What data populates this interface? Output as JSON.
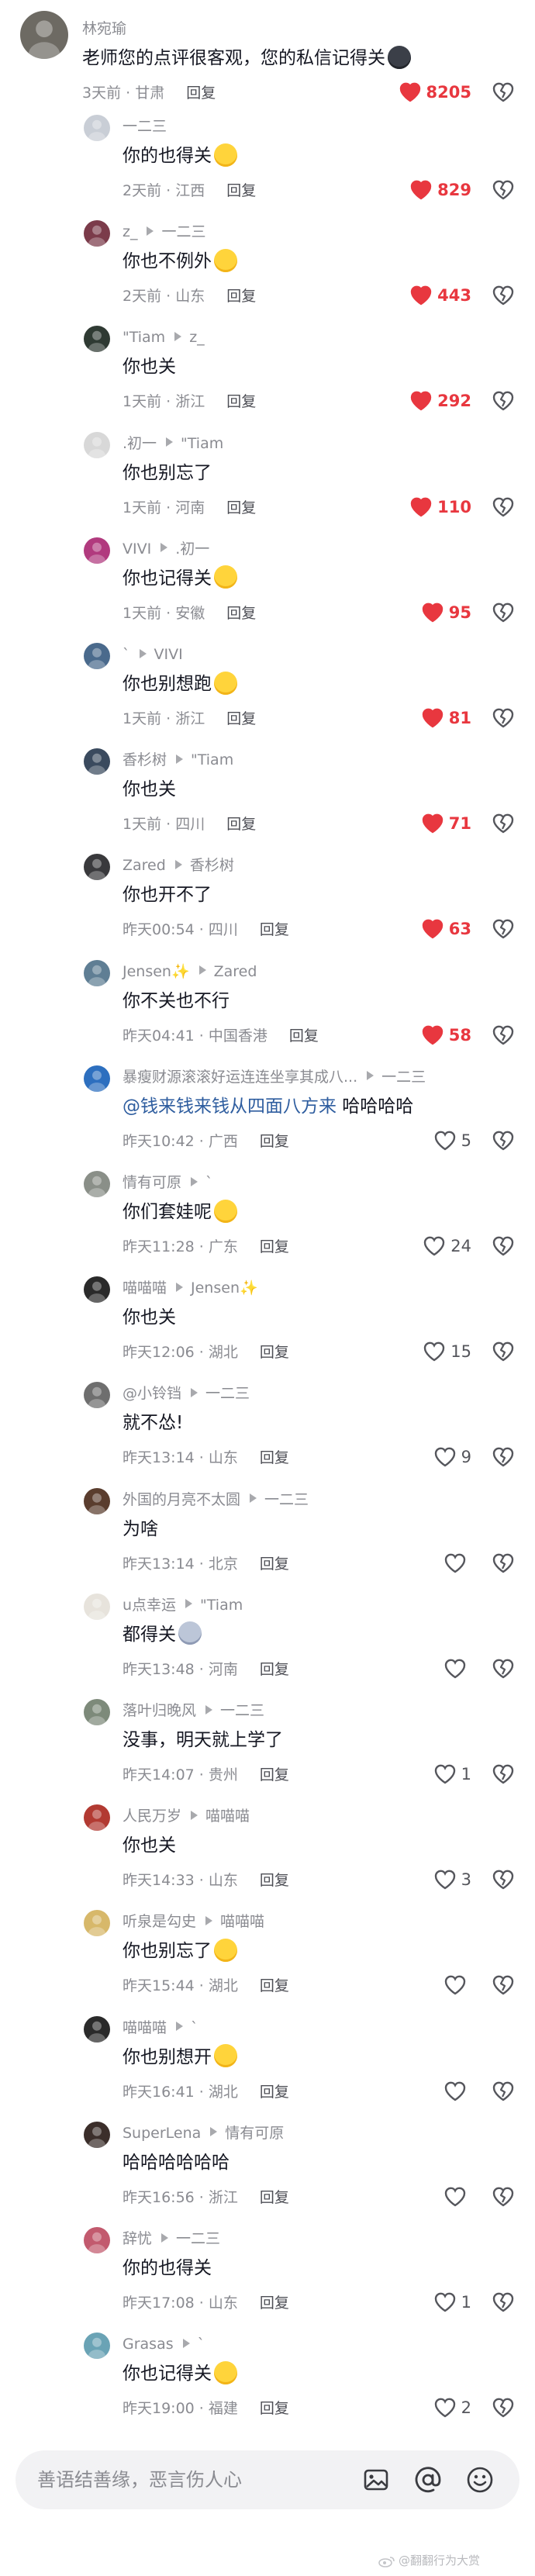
{
  "comments": [
    {
      "indent": false,
      "user": "林宛瑜",
      "reply_to": "",
      "text": "老师您的点评很客观，您的私信记得关",
      "emoji": "dark-face",
      "time": "3天前",
      "region": "甘肃",
      "reply_label": "回复",
      "likes": "8205",
      "liked": true,
      "avatar_color": "#6d6a63"
    },
    {
      "indent": true,
      "user": "一二三",
      "reply_to": "",
      "text": "你的也得关",
      "emoji": "smirk-face",
      "time": "2天前",
      "region": "江西",
      "reply_label": "回复",
      "likes": "829",
      "liked": true,
      "avatar_color": "#c9ced6"
    },
    {
      "indent": true,
      "user": "z_",
      "reply_to": "一二三",
      "text": "你也不例外",
      "emoji": "laugh-cry-face",
      "time": "2天前",
      "region": "山东",
      "reply_label": "回复",
      "likes": "443",
      "liked": true,
      "avatar_color": "#7b3b4a"
    },
    {
      "indent": true,
      "user": "\"Tiam",
      "reply_to": "z_",
      "text": "你也关",
      "emoji": "",
      "time": "1天前",
      "region": "浙江",
      "reply_label": "回复",
      "likes": "292",
      "liked": true,
      "avatar_color": "#2f3a33"
    },
    {
      "indent": true,
      "user": ".初一",
      "reply_to": "\"Tiam",
      "text": "你也别忘了",
      "emoji": "",
      "time": "1天前",
      "region": "河南",
      "reply_label": "回复",
      "likes": "110",
      "liked": true,
      "avatar_color": "#d8d8d8"
    },
    {
      "indent": true,
      "user": "VIVI",
      "reply_to": ".初一",
      "text": "你也记得关",
      "emoji": "crying-face",
      "time": "1天前",
      "region": "安徽",
      "reply_label": "回复",
      "likes": "95",
      "liked": true,
      "avatar_color": "#b13a7e"
    },
    {
      "indent": true,
      "user": "`",
      "reply_to": "VIVI",
      "text": "你也别想跑",
      "emoji": "laugh-cry-face",
      "time": "1天前",
      "region": "浙江",
      "reply_label": "回复",
      "likes": "81",
      "liked": true,
      "avatar_color": "#4a6a8c"
    },
    {
      "indent": true,
      "user": "香杉树",
      "reply_to": "\"Tiam",
      "text": "你也关",
      "emoji": "",
      "time": "1天前",
      "region": "四川",
      "reply_label": "回复",
      "likes": "71",
      "liked": true,
      "avatar_color": "#3a4a5e"
    },
    {
      "indent": true,
      "user": "Zared",
      "reply_to": "香杉树",
      "text": "你也开不了",
      "emoji": "",
      "time": "昨天00:54",
      "region": "四川",
      "reply_label": "回复",
      "likes": "63",
      "liked": true,
      "avatar_color": "#39393c"
    },
    {
      "indent": true,
      "user": "Jensen✨",
      "reply_to": "Zared",
      "text": "你不关也不行",
      "emoji": "",
      "time": "昨天04:41",
      "region": "中国香港",
      "reply_label": "回复",
      "likes": "58",
      "liked": true,
      "avatar_color": "#5f7e94"
    },
    {
      "indent": true,
      "user": "暴瘦财源滚滚好运连连坐享其成八...",
      "reply_to": "一二三",
      "text": "",
      "mention": "@钱来钱来钱从四面八方来",
      "text_after": " 哈哈哈哈",
      "emoji": "",
      "time": "昨天10:42",
      "region": "广西",
      "reply_label": "回复",
      "likes": "5",
      "liked": false,
      "avatar_color": "#2d6fbf"
    },
    {
      "indent": true,
      "user": "情有可原",
      "reply_to": "`",
      "text": "你们套娃呢",
      "emoji": "laugh-cry-face",
      "time": "昨天11:28",
      "region": "广东",
      "reply_label": "回复",
      "likes": "24",
      "liked": false,
      "avatar_color": "#8a8f88"
    },
    {
      "indent": true,
      "user": "喵喵喵",
      "reply_to": "Jensen✨",
      "text": "你也关",
      "emoji": "",
      "time": "昨天12:06",
      "region": "湖北",
      "reply_label": "回复",
      "likes": "15",
      "liked": false,
      "avatar_color": "#2a2a2a"
    },
    {
      "indent": true,
      "user": "@小铃铛",
      "reply_to": "一二三",
      "text": "就不怂!",
      "emoji": "",
      "time": "昨天13:14",
      "region": "山东",
      "reply_label": "回复",
      "likes": "9",
      "liked": false,
      "avatar_color": "#6e6e6e"
    },
    {
      "indent": true,
      "user": "外国的月亮不太圆",
      "reply_to": "一二三",
      "text": "为啥",
      "emoji": "",
      "time": "昨天13:14",
      "region": "北京",
      "reply_label": "回复",
      "likes": "",
      "liked": false,
      "avatar_color": "#5a3d2e"
    },
    {
      "indent": true,
      "user": "u点幸运",
      "reply_to": "\"Tiam",
      "text": "都得关",
      "emoji": "cat-face",
      "time": "昨天13:48",
      "region": "河南",
      "reply_label": "回复",
      "likes": "",
      "liked": false,
      "avatar_color": "#e7e3dc"
    },
    {
      "indent": true,
      "user": "落叶归晚风",
      "reply_to": "一二三",
      "text": "没事，明天就上学了",
      "emoji": "",
      "time": "昨天14:07",
      "region": "贵州",
      "reply_label": "回复",
      "likes": "1",
      "liked": false,
      "avatar_color": "#7d8a7a"
    },
    {
      "indent": true,
      "user": "人民万岁",
      "reply_to": "喵喵喵",
      "text": "你也关",
      "emoji": "",
      "time": "昨天14:33",
      "region": "山东",
      "reply_label": "回复",
      "likes": "3",
      "liked": false,
      "avatar_color": "#b23a32"
    },
    {
      "indent": true,
      "user": "听泉是勾史",
      "reply_to": "喵喵喵",
      "text": "你也别忘了",
      "emoji": "grin-face",
      "time": "昨天15:44",
      "region": "湖北",
      "reply_label": "回复",
      "likes": "",
      "liked": false,
      "avatar_color": "#d7b86a"
    },
    {
      "indent": true,
      "user": "喵喵喵",
      "reply_to": "`",
      "text": "你也别想开",
      "emoji": "smirk-face",
      "time": "昨天16:41",
      "region": "湖北",
      "reply_label": "回复",
      "likes": "",
      "liked": false,
      "avatar_color": "#2a2a2a"
    },
    {
      "indent": true,
      "user": "SuperLena",
      "reply_to": "情有可原",
      "text": "哈哈哈哈哈哈",
      "emoji": "",
      "time": "昨天16:56",
      "region": "浙江",
      "reply_label": "回复",
      "likes": "",
      "liked": false,
      "avatar_color": "#3b2e2a"
    },
    {
      "indent": true,
      "user": "辞忧",
      "reply_to": "一二三",
      "text": "你的也得关",
      "emoji": "",
      "time": "昨天17:08",
      "region": "山东",
      "reply_label": "回复",
      "likes": "1",
      "liked": false,
      "avatar_color": "#c25a6e"
    },
    {
      "indent": true,
      "user": "Grasas",
      "reply_to": "`",
      "text": "你也记得关",
      "emoji": "laugh-cry-face",
      "time": "昨天19:00",
      "region": "福建",
      "reply_label": "回复",
      "likes": "2",
      "liked": false,
      "avatar_color": "#6aa3b5"
    }
  ],
  "input_bar": {
    "placeholder": "善语结善缘，恶言伤人心",
    "icons": [
      "image-icon",
      "at-icon",
      "emoji-icon"
    ]
  },
  "watermark": "@翻翻行为大赏",
  "colors": {
    "liked": "#e8373f",
    "mention": "#2e5d9f",
    "meta": "#8a8b91"
  }
}
